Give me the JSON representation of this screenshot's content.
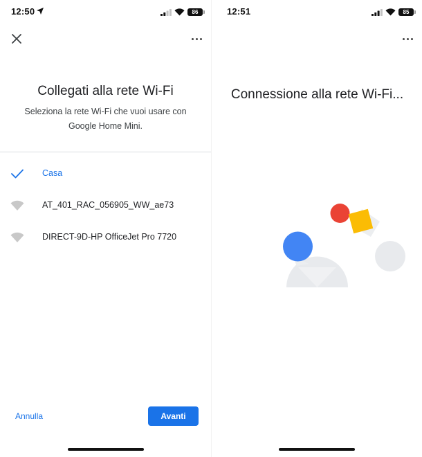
{
  "left": {
    "status": {
      "time": "12:50",
      "battery": "86"
    },
    "title": "Collegati alla rete Wi-Fi",
    "subtitle": "Seleziona la rete Wi-Fi che vuoi usare con Google Home Mini.",
    "networks": [
      {
        "name": "Casa",
        "selected": true
      },
      {
        "name": "AT_401_RAC_056905_WW_ae73",
        "selected": false
      },
      {
        "name": "DIRECT-9D-HP OfficeJet Pro 7720",
        "selected": false
      }
    ],
    "cancel_label": "Annulla",
    "next_label": "Avanti"
  },
  "right": {
    "status": {
      "time": "12:51",
      "battery": "85"
    },
    "title": "Connessione alla rete Wi-Fi..."
  },
  "colors": {
    "accent": "#1a73e8",
    "google_blue": "#4285f4",
    "google_red": "#ea4335",
    "google_yellow": "#fbbc04",
    "light_grey": "#e8eaed"
  },
  "icons": {
    "close": "close-icon",
    "more": "more-vert-icon",
    "check": "check-icon",
    "wifi": "wifi-icon",
    "location": "location-arrow-icon"
  }
}
